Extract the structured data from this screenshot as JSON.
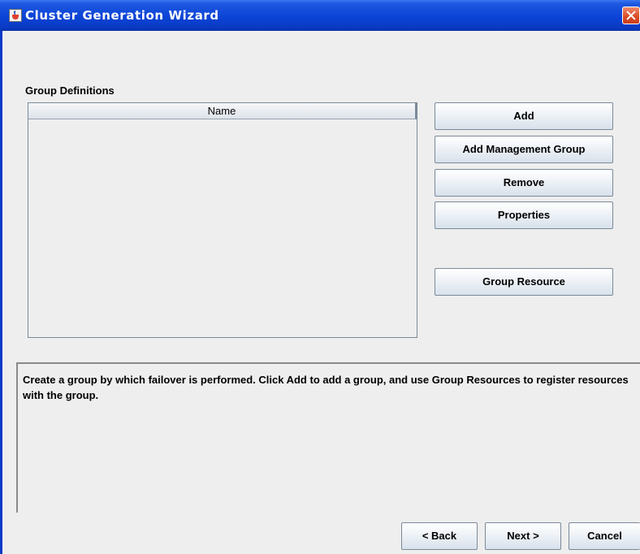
{
  "window": {
    "title": "Cluster Generation Wizard"
  },
  "group_definitions": {
    "label": "Group Definitions",
    "columns": [
      "Name"
    ],
    "rows": []
  },
  "buttons": {
    "add": "Add",
    "add_management_group": "Add Management Group",
    "remove": "Remove",
    "properties": "Properties",
    "group_resource": "Group Resource"
  },
  "description": "Create a group by which failover is performed. Click Add to add a group, and use Group Resources to register resources with the group.",
  "footer": {
    "back": "< Back",
    "next": "Next >",
    "cancel": "Cancel"
  },
  "colors": {
    "titlebar": "#0a3cc8",
    "dialog_bg": "#eeeeee",
    "close_button": "#d84a24"
  }
}
